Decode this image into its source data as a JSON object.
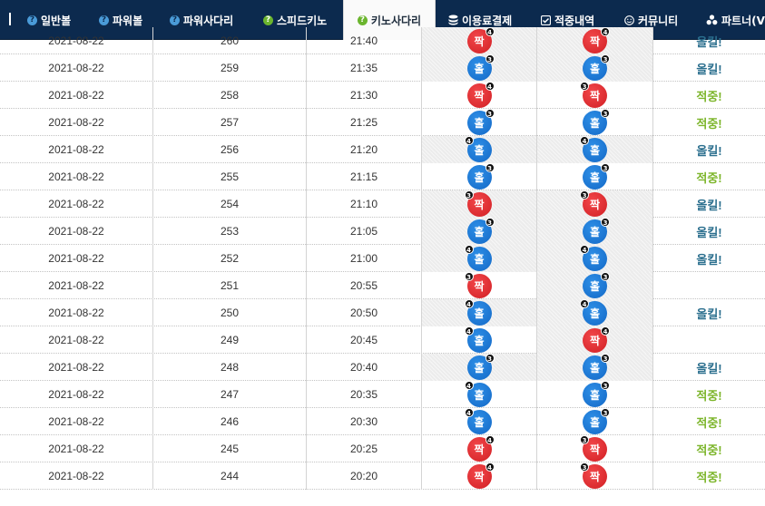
{
  "nav": {
    "tabs": [
      {
        "label": "일반볼",
        "icon": "question-circle-icon",
        "active": false
      },
      {
        "label": "파워볼",
        "icon": "question-circle-icon",
        "active": false
      },
      {
        "label": "파워사다리",
        "icon": "question-circle-icon",
        "active": false
      },
      {
        "label": "스피드키노",
        "icon": "question-circle-green-icon",
        "active": false
      },
      {
        "label": "키노사다리",
        "icon": "question-circle-green-icon",
        "active": true
      },
      {
        "label": "이용료결제",
        "icon": "database-icon",
        "active": false
      },
      {
        "label": "적중내역",
        "icon": "check-square-icon",
        "active": false
      },
      {
        "label": "커뮤니티",
        "icon": "smile-icon",
        "active": false
      },
      {
        "label": "파트너(V",
        "icon": "cubes-icon",
        "active": false
      }
    ]
  },
  "colors": {
    "nav_bg": "#0c2a4e",
    "ball_red": "#d11f24",
    "ball_blue": "#1469c7",
    "result_up": "#2b6f8e",
    "result_hit": "#7cb52a"
  },
  "rows": [
    {
      "date": "2021-08-22",
      "round": "260",
      "time": "21:40",
      "a": {
        "label": "짝",
        "color": "red",
        "n": "4",
        "pos": "right"
      },
      "b": {
        "label": "짝",
        "color": "red",
        "n": "4",
        "pos": "right"
      },
      "result": "올킬!",
      "result_type": "up",
      "hatch_a": true,
      "hatch_b": true
    },
    {
      "date": "2021-08-22",
      "round": "259",
      "time": "21:35",
      "a": {
        "label": "홀",
        "color": "blue",
        "n": "3",
        "pos": "right"
      },
      "b": {
        "label": "홀",
        "color": "blue",
        "n": "3",
        "pos": "right"
      },
      "result": "올킬!",
      "result_type": "up",
      "hatch_a": true,
      "hatch_b": true
    },
    {
      "date": "2021-08-22",
      "round": "258",
      "time": "21:30",
      "a": {
        "label": "짝",
        "color": "red",
        "n": "4",
        "pos": "right"
      },
      "b": {
        "label": "짝",
        "color": "red",
        "n": "3",
        "pos": "left"
      },
      "result": "적중!",
      "result_type": "hit",
      "hatch_a": false,
      "hatch_b": false
    },
    {
      "date": "2021-08-22",
      "round": "257",
      "time": "21:25",
      "a": {
        "label": "홀",
        "color": "blue",
        "n": "3",
        "pos": "right"
      },
      "b": {
        "label": "홀",
        "color": "blue",
        "n": "3",
        "pos": "right"
      },
      "result": "적중!",
      "result_type": "hit",
      "hatch_a": false,
      "hatch_b": false
    },
    {
      "date": "2021-08-22",
      "round": "256",
      "time": "21:20",
      "a": {
        "label": "홀",
        "color": "blue",
        "n": "4",
        "pos": "left"
      },
      "b": {
        "label": "홀",
        "color": "blue",
        "n": "4",
        "pos": "left"
      },
      "result": "올킬!",
      "result_type": "up",
      "hatch_a": true,
      "hatch_b": true
    },
    {
      "date": "2021-08-22",
      "round": "255",
      "time": "21:15",
      "a": {
        "label": "홀",
        "color": "blue",
        "n": "3",
        "pos": "right"
      },
      "b": {
        "label": "홀",
        "color": "blue",
        "n": "3",
        "pos": "right"
      },
      "result": "적중!",
      "result_type": "hit",
      "hatch_a": false,
      "hatch_b": false
    },
    {
      "date": "2021-08-22",
      "round": "254",
      "time": "21:10",
      "a": {
        "label": "짝",
        "color": "red",
        "n": "3",
        "pos": "left"
      },
      "b": {
        "label": "짝",
        "color": "red",
        "n": "3",
        "pos": "left"
      },
      "result": "올킬!",
      "result_type": "up",
      "hatch_a": true,
      "hatch_b": true
    },
    {
      "date": "2021-08-22",
      "round": "253",
      "time": "21:05",
      "a": {
        "label": "홀",
        "color": "blue",
        "n": "3",
        "pos": "right"
      },
      "b": {
        "label": "홀",
        "color": "blue",
        "n": "3",
        "pos": "right"
      },
      "result": "올킬!",
      "result_type": "up",
      "hatch_a": true,
      "hatch_b": true
    },
    {
      "date": "2021-08-22",
      "round": "252",
      "time": "21:00",
      "a": {
        "label": "홀",
        "color": "blue",
        "n": "4",
        "pos": "left"
      },
      "b": {
        "label": "홀",
        "color": "blue",
        "n": "4",
        "pos": "left"
      },
      "result": "올킬!",
      "result_type": "up",
      "hatch_a": true,
      "hatch_b": true
    },
    {
      "date": "2021-08-22",
      "round": "251",
      "time": "20:55",
      "a": {
        "label": "짝",
        "color": "red",
        "n": "3",
        "pos": "left"
      },
      "b": {
        "label": "홀",
        "color": "blue",
        "n": "3",
        "pos": "right"
      },
      "result": "",
      "result_type": "none",
      "hatch_a": false,
      "hatch_b": true
    },
    {
      "date": "2021-08-22",
      "round": "250",
      "time": "20:50",
      "a": {
        "label": "홀",
        "color": "blue",
        "n": "4",
        "pos": "left"
      },
      "b": {
        "label": "홀",
        "color": "blue",
        "n": "4",
        "pos": "left"
      },
      "result": "올킬!",
      "result_type": "up",
      "hatch_a": true,
      "hatch_b": true
    },
    {
      "date": "2021-08-22",
      "round": "249",
      "time": "20:45",
      "a": {
        "label": "홀",
        "color": "blue",
        "n": "4",
        "pos": "left"
      },
      "b": {
        "label": "짝",
        "color": "red",
        "n": "4",
        "pos": "right"
      },
      "result": "",
      "result_type": "none",
      "hatch_a": false,
      "hatch_b": true
    },
    {
      "date": "2021-08-22",
      "round": "248",
      "time": "20:40",
      "a": {
        "label": "홀",
        "color": "blue",
        "n": "3",
        "pos": "right"
      },
      "b": {
        "label": "홀",
        "color": "blue",
        "n": "3",
        "pos": "right"
      },
      "result": "올킬!",
      "result_type": "up",
      "hatch_a": true,
      "hatch_b": true
    },
    {
      "date": "2021-08-22",
      "round": "247",
      "time": "20:35",
      "a": {
        "label": "홀",
        "color": "blue",
        "n": "4",
        "pos": "left"
      },
      "b": {
        "label": "홀",
        "color": "blue",
        "n": "3",
        "pos": "right"
      },
      "result": "적중!",
      "result_type": "hit",
      "hatch_a": false,
      "hatch_b": false
    },
    {
      "date": "2021-08-22",
      "round": "246",
      "time": "20:30",
      "a": {
        "label": "홀",
        "color": "blue",
        "n": "4",
        "pos": "left"
      },
      "b": {
        "label": "홀",
        "color": "blue",
        "n": "3",
        "pos": "right"
      },
      "result": "적중!",
      "result_type": "hit",
      "hatch_a": false,
      "hatch_b": false
    },
    {
      "date": "2021-08-22",
      "round": "245",
      "time": "20:25",
      "a": {
        "label": "짝",
        "color": "red",
        "n": "4",
        "pos": "right"
      },
      "b": {
        "label": "짝",
        "color": "red",
        "n": "3",
        "pos": "left"
      },
      "result": "적중!",
      "result_type": "hit",
      "hatch_a": false,
      "hatch_b": false
    },
    {
      "date": "2021-08-22",
      "round": "244",
      "time": "20:20",
      "a": {
        "label": "짝",
        "color": "red",
        "n": "4",
        "pos": "right"
      },
      "b": {
        "label": "짝",
        "color": "red",
        "n": "3",
        "pos": "left"
      },
      "result": "적중!",
      "result_type": "hit",
      "hatch_a": false,
      "hatch_b": false
    }
  ]
}
